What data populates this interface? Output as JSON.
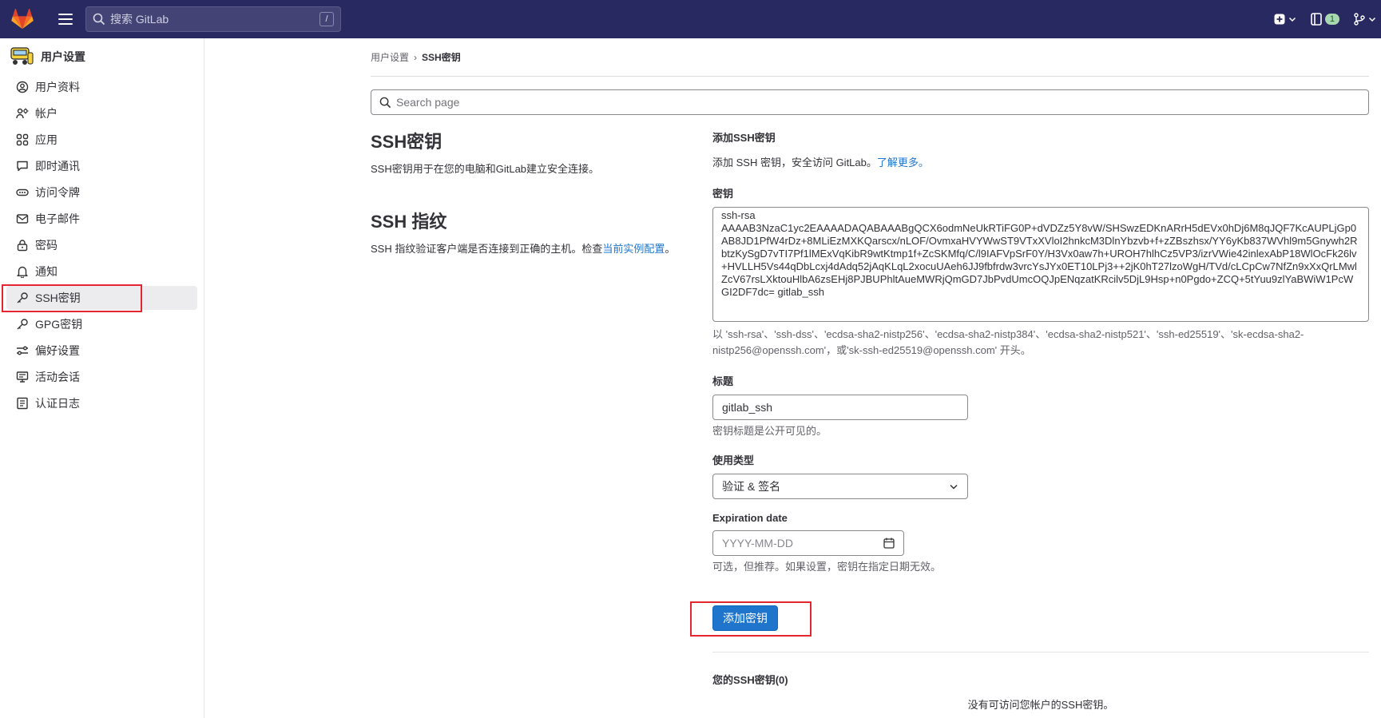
{
  "topbar": {
    "search_placeholder": "搜索 GitLab",
    "search_shortcut": "/",
    "merge_badge": "1"
  },
  "sidebar": {
    "title": "用户设置",
    "items": [
      {
        "label": "用户资料",
        "icon": "profile-icon"
      },
      {
        "label": "帐户",
        "icon": "account-icon"
      },
      {
        "label": "应用",
        "icon": "applications-icon"
      },
      {
        "label": "即时通讯",
        "icon": "chat-icon"
      },
      {
        "label": "访问令牌",
        "icon": "token-icon"
      },
      {
        "label": "电子邮件",
        "icon": "mail-icon"
      },
      {
        "label": "密码",
        "icon": "lock-icon"
      },
      {
        "label": "通知",
        "icon": "bell-icon"
      },
      {
        "label": "SSH密钥",
        "icon": "key-icon"
      },
      {
        "label": "GPG密钥",
        "icon": "key-icon"
      },
      {
        "label": "偏好设置",
        "icon": "preferences-icon"
      },
      {
        "label": "活动会话",
        "icon": "monitor-icon"
      },
      {
        "label": "认证日志",
        "icon": "log-icon"
      }
    ],
    "active_item": "SSH密钥"
  },
  "breadcrumb": {
    "parent": "用户设置",
    "separator": "›",
    "current": "SSH密钥"
  },
  "page_search": {
    "placeholder": "Search page"
  },
  "left": {
    "ssh_title": "SSH密钥",
    "ssh_desc": "SSH密钥用于在您的电脑和GitLab建立安全连接。",
    "fp_title": "SSH 指纹",
    "fp_desc": "SSH 指纹验证客户端是否连接到正确的主机。检查",
    "fp_link": "当前实例配置",
    "fp_end": "。"
  },
  "form": {
    "add_title": "添加SSH密钥",
    "add_desc": "添加 SSH 密钥，安全访问 GitLab。",
    "learn_more": "了解更多。",
    "key_label": "密钥",
    "key_value": "ssh-rsa\nAAAAB3NzaC1yc2EAAAADAQABAAABgQCX6odmNeUkRTiFG0P+dVDZz5Y8vW/SHSwzEDKnARrH5dEVx0hDj6M8qJQF7KcAUPLjGp0AB8JD1PfW4rDz+8MLiEzMXKQarscx/nLOF/OvmxaHVYWwST9VTxXVloI2hnkcM3DlnYbzvb+f+zZBszhsx/YY6yKb837WVhl9m5Gnywh2RbtzKySgD7vTI7Pf1lMExVqKibR9wtKtmp1f+ZcSKMfq/C/l9IAFVpSrF0Y/H3Vx0aw7h+UROH7hlhCz5VP3/izrVWie42inlexAbP18WlOcFk26lv+HVLLH5Vs44qDbLcxj4dAdq52jAqKLqL2xocuUAeh6JJ9fbfrdw3vrcYsJYx0ET10LPj3++2jK0hT27lzoWgH/TVd/cLCpCw7NfZn9xXxQrLMwlZcV67rsLXktouHlbA6zsEHj8PJBUPhltAueMWRjQmGD7JbPvdUmcOQJpENqzatKRcilv5DjL9Hsp+n0Pgdo+ZCQ+5tYuu9zlYaBWiW1PcWGI2DF7dc= gitlab_ssh",
    "key_help": "以 'ssh-rsa'、'ssh-dss'、'ecdsa-sha2-nistp256'、'ecdsa-sha2-nistp384'、'ecdsa-sha2-nistp521'、'ssh-ed25519'、'sk-ecdsa-sha2-nistp256@openssh.com'，或'sk-ssh-ed25519@openssh.com' 开头。",
    "title_label": "标题",
    "title_value": "gitlab_ssh",
    "title_help": "密钥标题是公开可见的。",
    "usage_label": "使用类型",
    "usage_value": "验证 & 签名",
    "expiration_label": "Expiration date",
    "expiration_placeholder": "YYYY-MM-DD",
    "expiration_help": "可选，但推荐。如果设置，密钥在指定日期无效。",
    "submit_label": "添加密钥"
  },
  "keys_list": {
    "title": "您的SSH密钥(0)",
    "empty": "没有可访问您帐户的SSH密钥。"
  },
  "colors": {
    "topbar": "#292961",
    "primary": "#1f75cb",
    "highlight": "#e3262f"
  }
}
